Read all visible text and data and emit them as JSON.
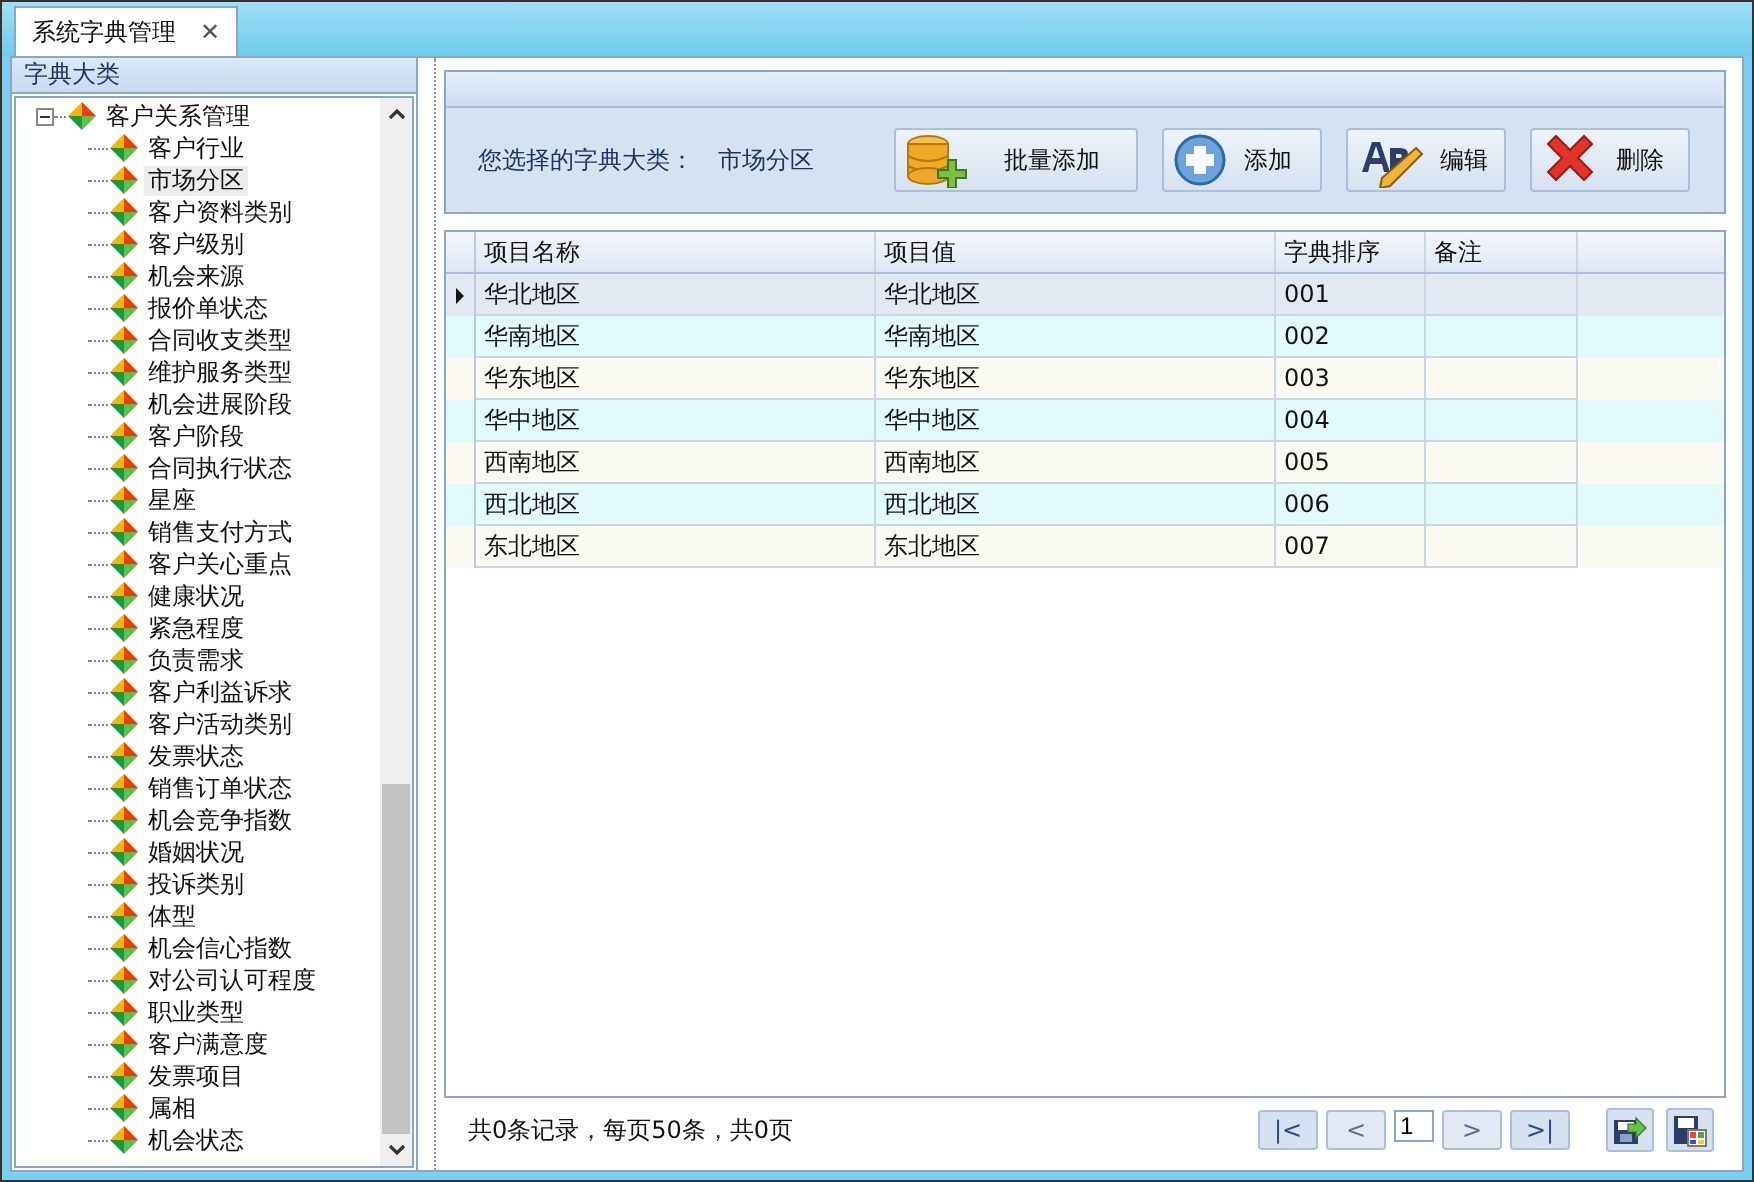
{
  "tabs": [
    {
      "label": "系统字典管理",
      "close": "✕",
      "selected": true
    }
  ],
  "sidebar": {
    "title": "字典大类",
    "tree": [
      {
        "label": "客户关系管理",
        "expanded": true,
        "selected": false,
        "children": [
          {
            "label": "客户行业",
            "selected": false
          },
          {
            "label": "市场分区",
            "selected": true
          },
          {
            "label": "客户资料类别",
            "selected": false
          },
          {
            "label": "客户级别",
            "selected": false
          },
          {
            "label": "机会来源",
            "selected": false
          },
          {
            "label": "报价单状态",
            "selected": false
          },
          {
            "label": "合同收支类型",
            "selected": false
          },
          {
            "label": "维护服务类型",
            "selected": false
          },
          {
            "label": "机会进展阶段",
            "selected": false
          },
          {
            "label": "客户阶段",
            "selected": false
          },
          {
            "label": "合同执行状态",
            "selected": false
          },
          {
            "label": "星座",
            "selected": false
          },
          {
            "label": "销售支付方式",
            "selected": false
          },
          {
            "label": "客户关心重点",
            "selected": false
          },
          {
            "label": "健康状况",
            "selected": false
          },
          {
            "label": "紧急程度",
            "selected": false
          },
          {
            "label": "负责需求",
            "selected": false
          },
          {
            "label": "客户利益诉求",
            "selected": false
          },
          {
            "label": "客户活动类别",
            "selected": false
          },
          {
            "label": "发票状态",
            "selected": false
          },
          {
            "label": "销售订单状态",
            "selected": false
          },
          {
            "label": "机会竞争指数",
            "selected": false
          },
          {
            "label": "婚姻状况",
            "selected": false
          },
          {
            "label": "投诉类别",
            "selected": false
          },
          {
            "label": "体型",
            "selected": false
          },
          {
            "label": "机会信心指数",
            "selected": false
          },
          {
            "label": "对公司认可程度",
            "selected": false
          },
          {
            "label": "职业类型",
            "selected": false
          },
          {
            "label": "客户满意度",
            "selected": false
          },
          {
            "label": "发票项目",
            "selected": false
          },
          {
            "label": "属相",
            "selected": false
          },
          {
            "label": "机会状态",
            "selected": false
          }
        ]
      }
    ]
  },
  "toolbar": {
    "label": "您选择的字典大类：",
    "value": "市场分区",
    "buttons": [
      {
        "kind": "batch",
        "label": "批量添加"
      },
      {
        "kind": "add",
        "label": "添加"
      },
      {
        "kind": "edit",
        "label": "编辑"
      },
      {
        "kind": "delete",
        "label": "删除"
      }
    ]
  },
  "table": {
    "columns": [
      "项目名称",
      "项目值",
      "字典排序",
      "备注"
    ],
    "rows": [
      {
        "cells": [
          "华北地区",
          "华北地区",
          "001",
          ""
        ],
        "selected": true
      },
      {
        "cells": [
          "华南地区",
          "华南地区",
          "002",
          ""
        ],
        "selected": false
      },
      {
        "cells": [
          "华东地区",
          "华东地区",
          "003",
          ""
        ],
        "selected": false
      },
      {
        "cells": [
          "华中地区",
          "华中地区",
          "004",
          ""
        ],
        "selected": false
      },
      {
        "cells": [
          "西南地区",
          "西南地区",
          "005",
          ""
        ],
        "selected": false
      },
      {
        "cells": [
          "西北地区",
          "西北地区",
          "006",
          ""
        ],
        "selected": false
      },
      {
        "cells": [
          "东北地区",
          "东北地区",
          "007",
          ""
        ],
        "selected": false
      }
    ]
  },
  "status_bar": {
    "summary": "共0条记录，每页50条，共0页",
    "pager": [
      {
        "kind": "first",
        "label": "|<",
        "disabled": false
      },
      {
        "kind": "prev",
        "label": "<",
        "disabled": true
      },
      {
        "kind": "page",
        "value": "1"
      },
      {
        "kind": "next",
        "label": ">",
        "disabled": true
      },
      {
        "kind": "last",
        "label": ">|",
        "disabled": false
      }
    ],
    "actions": [
      {
        "kind": "export"
      },
      {
        "kind": "save"
      }
    ]
  }
}
